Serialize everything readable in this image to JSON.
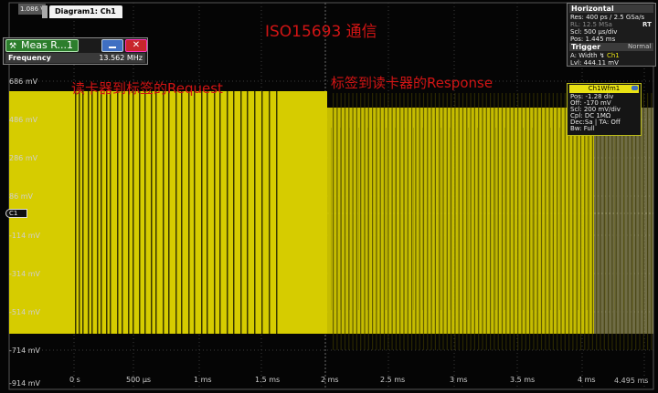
{
  "scope": {
    "title": "ISO15693 通信",
    "diagram_tab": "Diagram1: Ch1",
    "top_voltage": "1.086 V",
    "channel_marker": "C1",
    "colors": {
      "trace": "#d6cc00",
      "background": "#050505",
      "grid": "#3a3a3a",
      "annotation": "#d11414",
      "meas_green": "#2c7e2c"
    }
  },
  "annotations": {
    "request": "读卡器到标签的Request",
    "response": "标签到读卡器的Response"
  },
  "y_axis": {
    "labels": [
      "686 mV",
      "486 mV",
      "286 mV",
      "86 mV",
      "-114 mV",
      "-314 mV",
      "-514 mV",
      "-714 mV",
      "-914 mV"
    ]
  },
  "x_axis": {
    "labels": [
      "0 s",
      "500 µs",
      "1 ms",
      "1.5 ms",
      "2 ms",
      "2.5 ms",
      "3 ms",
      "3.5 ms",
      "4 ms"
    ],
    "end_label": "4.495 ms"
  },
  "meas": {
    "title": "Meas R...1",
    "row_label": "Frequency",
    "row_value": "13.562 MHz",
    "icon": "wrench-icon"
  },
  "horizontal": {
    "header": "Horizontal",
    "res": "Res: 400 ps / 2.5 GSa/s",
    "rl": "RL:",
    "rl_value": "12.5 MSa",
    "rt": "RT",
    "scl": "Scl:",
    "scl_value": "500 µs/div",
    "pos": "Pos:",
    "pos_value": "1.445 ms"
  },
  "trigger": {
    "header": "Trigger",
    "mode": "Normal",
    "a": "A:",
    "a_type": "Width",
    "a_source": "Ch1",
    "lvl": "Lvl:",
    "lvl_value": "444.11 mV"
  },
  "wfm": {
    "header": "Ch1Wfm1",
    "pos": "Pos: -1.28 div",
    "off": "Off: -170 mV",
    "scl": "Scl: 200 mV/div",
    "cpl": "Cpl: DC 1MΩ",
    "dec": "Dec:Sa | TA: Off",
    "bw": "Bw: Full"
  }
}
